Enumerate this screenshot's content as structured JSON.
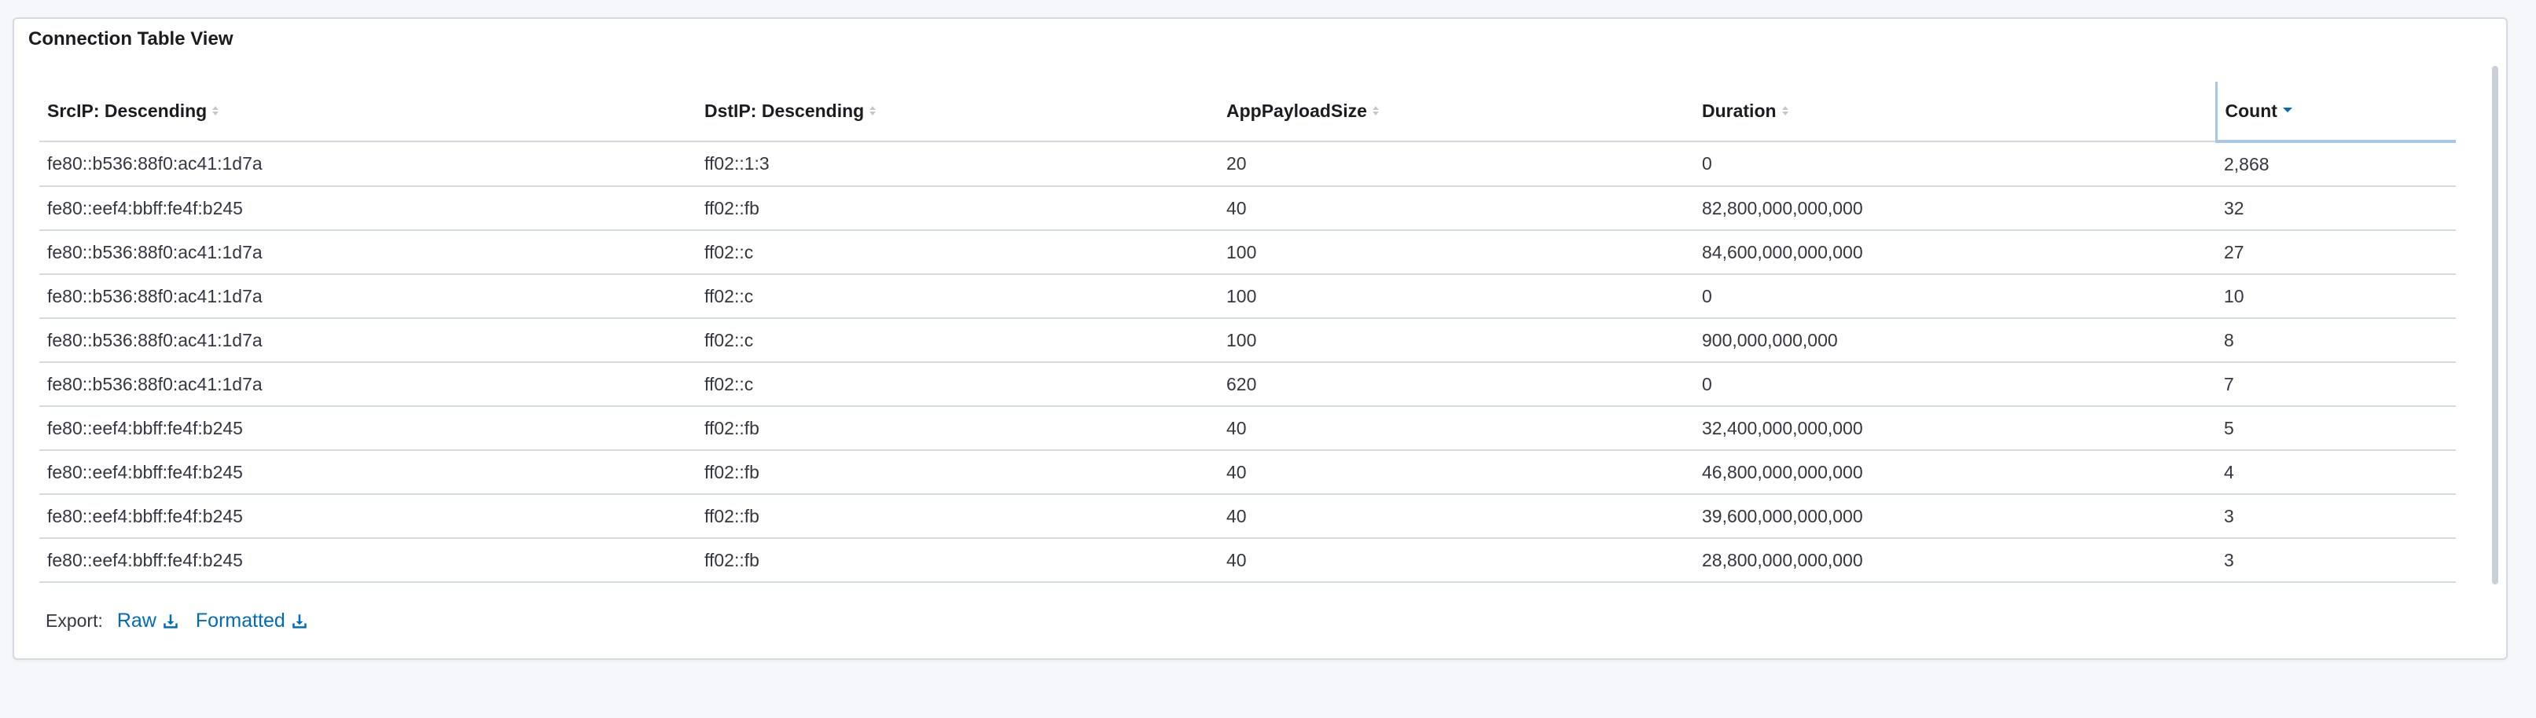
{
  "panel": {
    "title": "Connection Table View"
  },
  "table": {
    "columns": [
      {
        "label": "SrcIP: Descending",
        "sort": "none"
      },
      {
        "label": "DstIP: Descending",
        "sort": "none"
      },
      {
        "label": "AppPayloadSize",
        "sort": "none"
      },
      {
        "label": "Duration",
        "sort": "none"
      },
      {
        "label": "Count",
        "sort": "desc"
      }
    ],
    "rows": [
      [
        "fe80::b536:88f0:ac41:1d7a",
        "ff02::1:3",
        "20",
        "0",
        "2,868"
      ],
      [
        "fe80::eef4:bbff:fe4f:b245",
        "ff02::fb",
        "40",
        "82,800,000,000,000",
        "32"
      ],
      [
        "fe80::b536:88f0:ac41:1d7a",
        "ff02::c",
        "100",
        "84,600,000,000,000",
        "27"
      ],
      [
        "fe80::b536:88f0:ac41:1d7a",
        "ff02::c",
        "100",
        "0",
        "10"
      ],
      [
        "fe80::b536:88f0:ac41:1d7a",
        "ff02::c",
        "100",
        "900,000,000,000",
        "8"
      ],
      [
        "fe80::b536:88f0:ac41:1d7a",
        "ff02::c",
        "620",
        "0",
        "7"
      ],
      [
        "fe80::eef4:bbff:fe4f:b245",
        "ff02::fb",
        "40",
        "32,400,000,000,000",
        "5"
      ],
      [
        "fe80::eef4:bbff:fe4f:b245",
        "ff02::fb",
        "40",
        "46,800,000,000,000",
        "4"
      ],
      [
        "fe80::eef4:bbff:fe4f:b245",
        "ff02::fb",
        "40",
        "39,600,000,000,000",
        "3"
      ],
      [
        "fe80::eef4:bbff:fe4f:b245",
        "ff02::fb",
        "40",
        "28,800,000,000,000",
        "3"
      ]
    ]
  },
  "export": {
    "label": "Export:",
    "raw_label": "Raw",
    "formatted_label": "Formatted",
    "icon": "download-icon"
  },
  "colors": {
    "link": "#006bb8",
    "sort_active": "#006bb8",
    "border": "#d3dae6",
    "sorted_column_highlight": "#a8c6e6"
  }
}
